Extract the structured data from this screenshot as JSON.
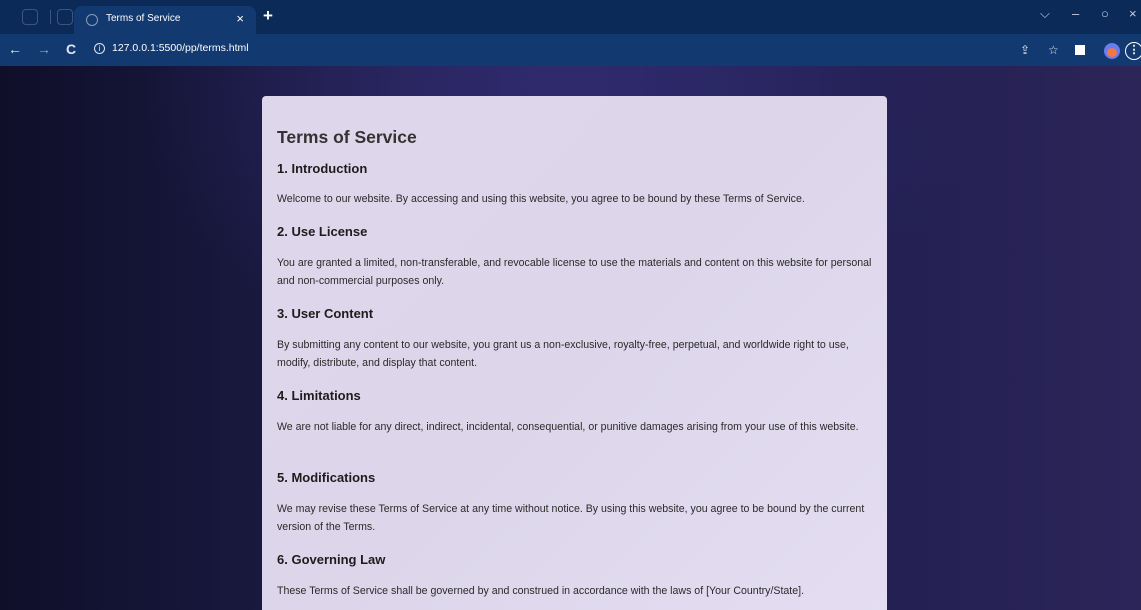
{
  "browser": {
    "tab_title": "Terms of Service",
    "tab_close": "×",
    "new_tab": "+",
    "url": "127.0.0.1:5500/pp/terms.html",
    "controls": {
      "dropdown": "⌵",
      "minimize": "–",
      "restore": "○",
      "close": "×"
    },
    "nav": {
      "back": "←",
      "forward": "→",
      "reload": "C"
    },
    "tools": {
      "share": "⇪",
      "bookmark": "☆",
      "menu": "⋮"
    }
  },
  "page": {
    "title": "Terms of Service",
    "sections": [
      {
        "heading": "1. Introduction",
        "body": "Welcome to our website. By accessing and using this website, you agree to be bound by these Terms of Service."
      },
      {
        "heading": "2. Use License",
        "body": "You are granted a limited, non-transferable, and revocable license to use the materials and content on this website for personal and non-commercial purposes only."
      },
      {
        "heading": "3. User Content",
        "body": "By submitting any content to our website, you grant us a non-exclusive, royalty-free, perpetual, and worldwide right to use, modify, distribute, and display that content."
      },
      {
        "heading": "4. Limitations",
        "body": "We are not liable for any direct, indirect, incidental, consequential, or punitive damages arising from your use of this website."
      },
      {
        "heading": "5. Modifications",
        "body": "We may revise these Terms of Service at any time without notice. By using this website, you agree to be bound by the current version of the Terms."
      },
      {
        "heading": "6. Governing Law",
        "body": "These Terms of Service shall be governed by and construed in accordance with the laws of [Your Country/State]."
      }
    ]
  }
}
